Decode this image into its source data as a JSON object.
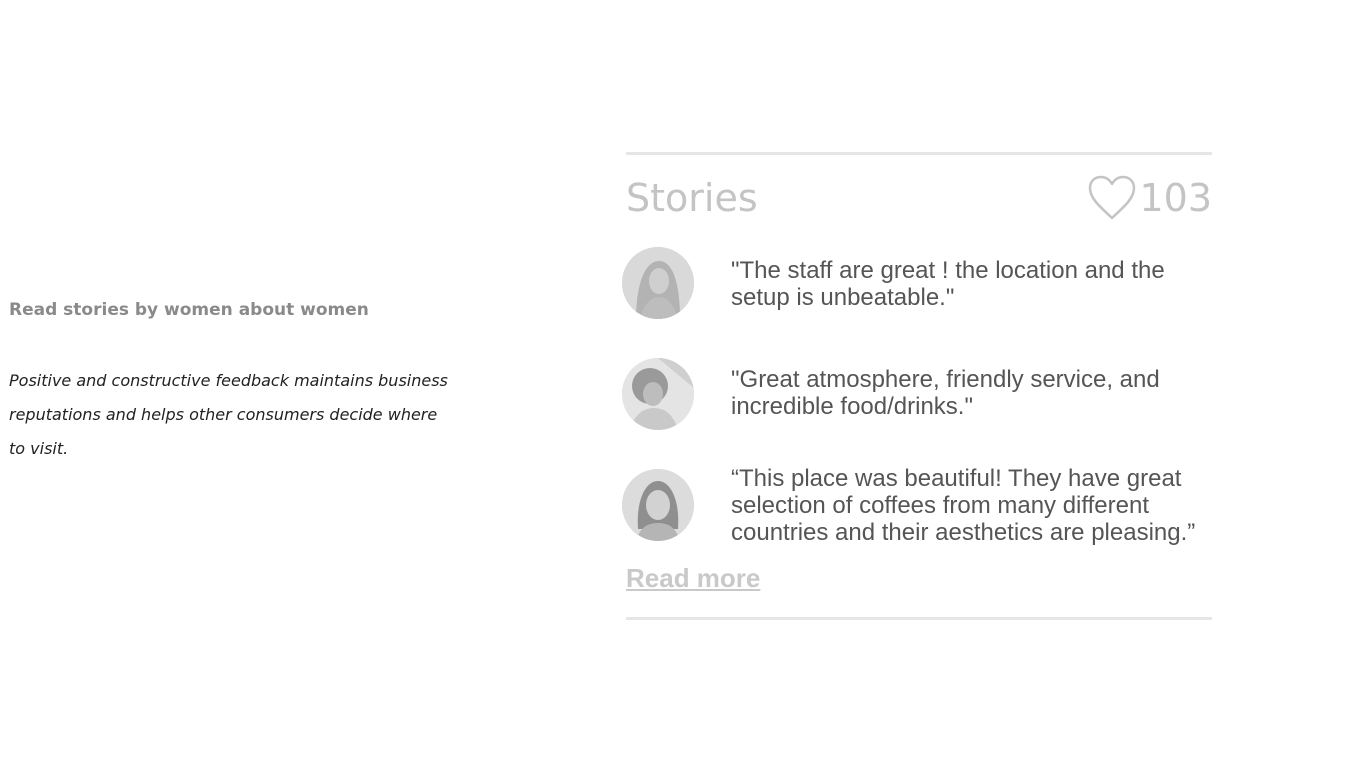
{
  "intro": {
    "heading": "Read stories by women about women",
    "body": "Positive and constructive feedback maintains business reputations and helps other consumers decide where to visit."
  },
  "stories": {
    "title": "Stories",
    "like_icon": "heart-outline-icon",
    "like_count": "103",
    "items": [
      {
        "avatar": "avatar-woman-1",
        "quote": "\"The staff are great ! the location and the setup is unbeatable.\""
      },
      {
        "avatar": "avatar-woman-2",
        "quote": "\"Great atmosphere, friendly service, and incredible food/drinks.\""
      },
      {
        "avatar": "avatar-woman-3",
        "quote": "“This place was beautiful! They have great selection of coffees from many different countries and their aesthetics are pleasing.”"
      }
    ],
    "read_more": "Read more"
  },
  "colors": {
    "muted_text": "#c4c4c4",
    "heading_gray": "#8a8a8a",
    "quote_text": "#555555",
    "divider": "#e6e6e6"
  }
}
